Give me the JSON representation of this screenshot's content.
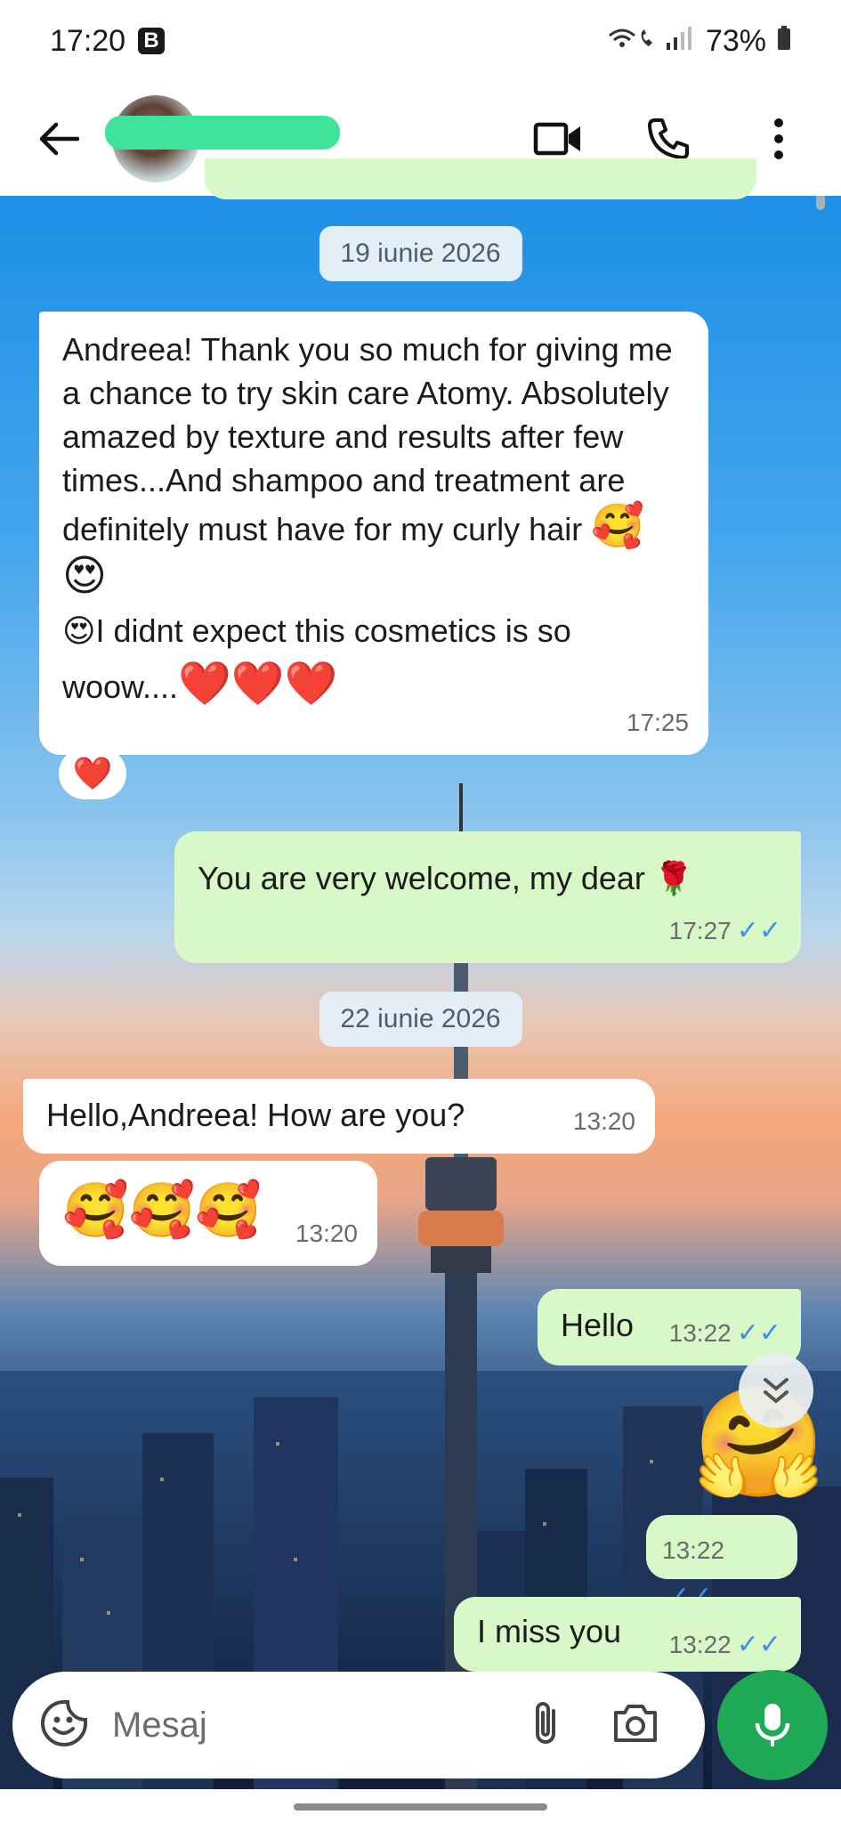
{
  "status_bar": {
    "time": "17:20",
    "badge": "B",
    "battery": "73%"
  },
  "header": {
    "contact_name": ""
  },
  "messages": {
    "date1": "19 iunie 2026",
    "m1_text": "Andreea! Thank you so much for giving me a chance to try skin care Atomy. Absolutely amazed by texture and results after  few times...And shampoo and treatment are definitely must have for my curly hair",
    "m1_emoji_a": "🥰😍",
    "m1_text2": "😍I didnt expect this cosmetics is so",
    "m1_text3": "woow....",
    "m1_hearts": "❤️❤️❤️",
    "m1_time": "17:25",
    "m1_reaction": "❤️",
    "m2_text": "You are very welcome, my dear 🌹",
    "m2_time": "17:27",
    "date2": "22 iunie 2026",
    "m3_text": "Hello,Andreea! How are you?",
    "m3_time": "13:20",
    "m4_emoji": "🥰🥰🥰",
    "m4_time": "13:20",
    "m5_text": "Hello",
    "m5_time": "13:22",
    "m6_sticker": "🤗",
    "m6_time": "13:22",
    "m7_text": "I miss you",
    "m7_time": "13:22",
    "tick_symbol": "✓✓"
  },
  "input": {
    "placeholder": "Mesaj"
  },
  "colors": {
    "outgoing_bubble": "#d8f8c8",
    "incoming_bubble": "#ffffff",
    "accent_green": "#1fa855",
    "read_ticks": "#3c8ef0"
  }
}
